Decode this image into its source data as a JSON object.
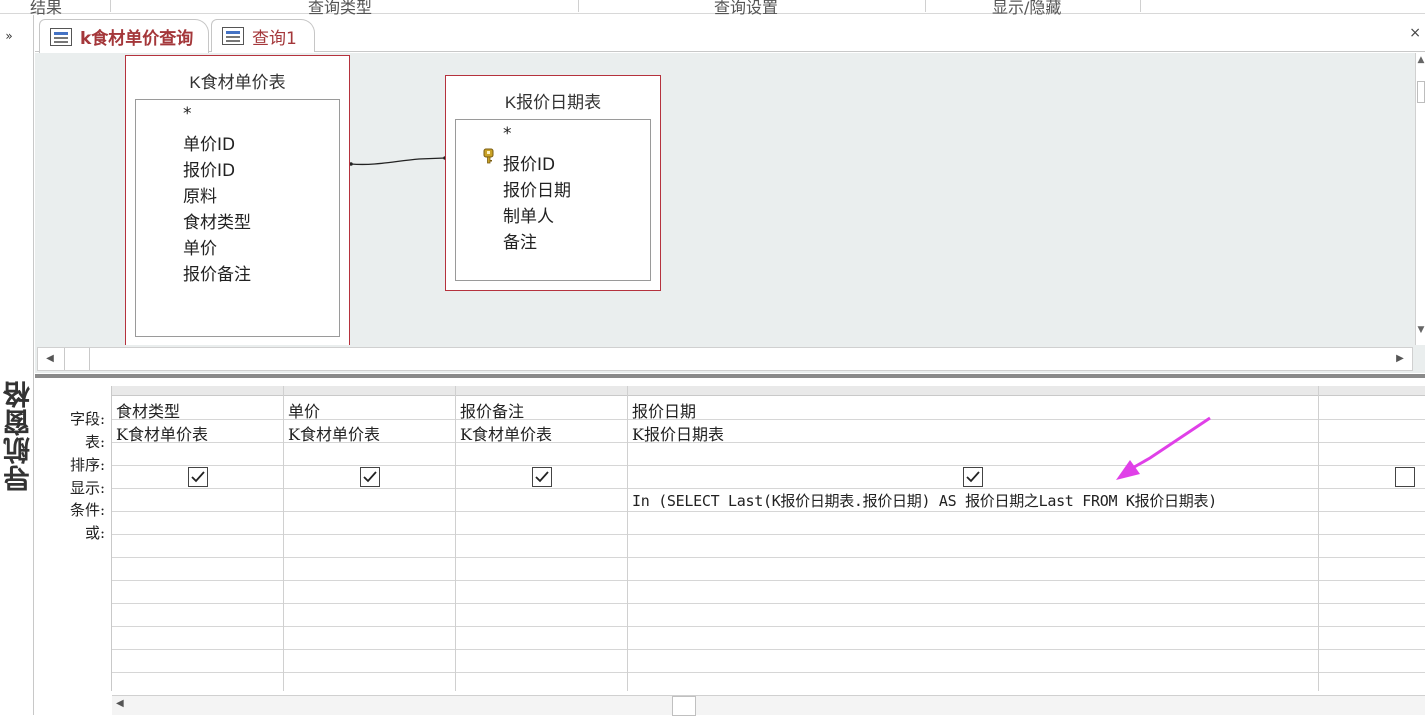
{
  "ribbon": {
    "groups": [
      "结果",
      "查询类型",
      "查询设置",
      "显示/隐藏"
    ]
  },
  "nav_pane": {
    "toggle_label": "»",
    "title": "导航窗格"
  },
  "tabs": [
    {
      "label": "k食材单价查询",
      "active": true
    },
    {
      "label": "查询1",
      "active": false
    }
  ],
  "close_label": "×",
  "tables": [
    {
      "title": "K食材单价表",
      "fields": [
        "*",
        "单价ID",
        "报价ID",
        "原料",
        "食材类型",
        "单价",
        "报价备注"
      ]
    },
    {
      "title": "K报价日期表",
      "fields": [
        "*",
        "报价ID",
        "报价日期",
        "制单人",
        "备注"
      ],
      "key_field": "报价ID"
    }
  ],
  "grid": {
    "row_labels": {
      "field": "字段:",
      "table": "表:",
      "sort": "排序:",
      "show": "显示:",
      "criteria": "条件:",
      "or": "或:"
    },
    "columns": [
      {
        "field": "食材类型",
        "table": "K食材单价表",
        "show": true,
        "criteria": ""
      },
      {
        "field": "单价",
        "table": "K食材单价表",
        "show": true,
        "criteria": ""
      },
      {
        "field": "报价备注",
        "table": "K食材单价表",
        "show": true,
        "criteria": ""
      },
      {
        "field": "报价日期",
        "table": "K报价日期表",
        "show": true,
        "criteria": "In (SELECT Last(K报价日期表.报价日期) AS 报价日期之Last FROM K报价日期表)"
      },
      {
        "field": "",
        "table": "",
        "show": false,
        "criteria": ""
      }
    ]
  },
  "colors": {
    "accent": "#a4373a",
    "table_border": "#b5323d",
    "annotation": "#e040e8",
    "design_bg": "#eaeeee"
  },
  "icons": [
    "query-icon",
    "key-icon",
    "checkbox-icon",
    "scroll-arrow-icon"
  ]
}
